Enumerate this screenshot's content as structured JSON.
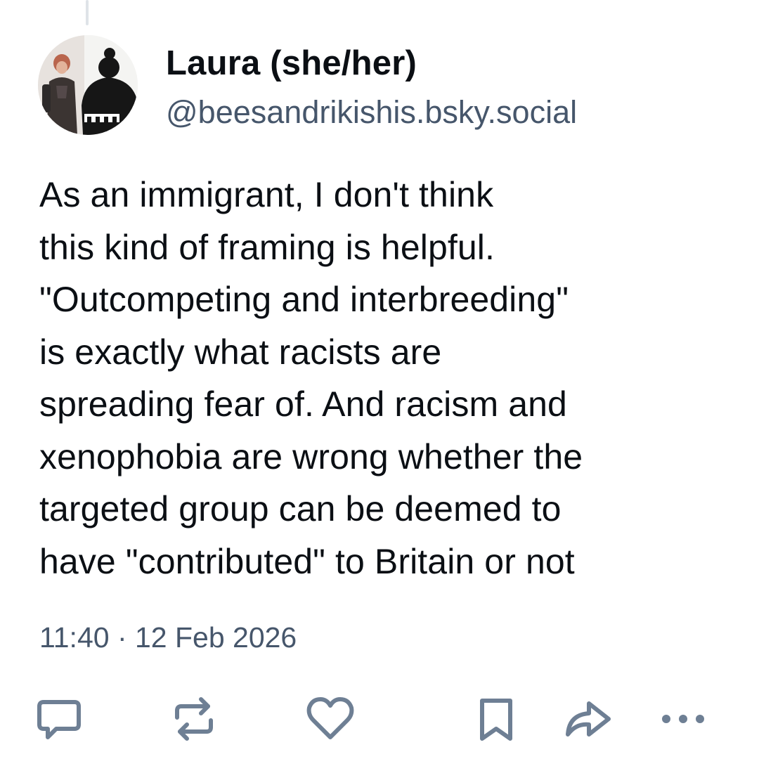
{
  "post": {
    "author": {
      "display_name": "Laura (she/her)",
      "handle": "@beesandrikishis.bsky.social",
      "avatar": "avatar-image"
    },
    "text_lines": [
      "As an immigrant, I don't think",
      "this kind of framing is helpful.",
      "\"Outcompeting and interbreeding\"",
      "is exactly what racists are",
      "spreading fear of. And racism and",
      "xenophobia are wrong whether the",
      "targeted group can be deemed to",
      "have \"contributed\" to Britain or not"
    ],
    "timestamp": "11:40 · 12 Feb 2026"
  },
  "actions": [
    {
      "name": "reply",
      "icon": "speech-bubble-icon"
    },
    {
      "name": "repost",
      "icon": "repost-icon"
    },
    {
      "name": "like",
      "icon": "heart-icon"
    },
    {
      "name": "bookmark",
      "icon": "bookmark-icon"
    },
    {
      "name": "share",
      "icon": "share-arrow-icon"
    },
    {
      "name": "more",
      "icon": "ellipsis-icon"
    }
  ],
  "colors": {
    "text_primary": "#0b0f14",
    "text_secondary": "#46566b",
    "icon": "#6e7f94",
    "thread_line": "#dfe3e8"
  }
}
